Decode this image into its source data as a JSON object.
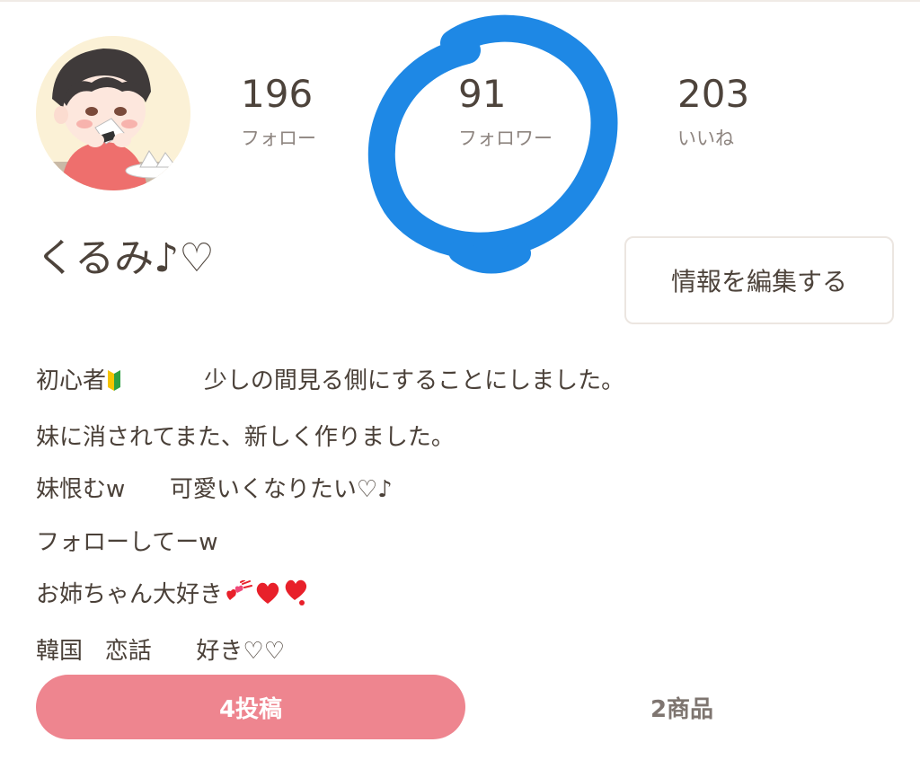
{
  "profile": {
    "username": "くるみ♪♡",
    "avatar_icon": "avatar-illustration"
  },
  "stats": {
    "following": {
      "count": "196",
      "label": "フォロー"
    },
    "followers": {
      "count": "91",
      "label": "フォロワー"
    },
    "likes": {
      "count": "203",
      "label": "いいね"
    }
  },
  "actions": {
    "edit_label": "情報を編集する"
  },
  "bio": {
    "line1_prefix": "初心者",
    "line1_suffix": "           少しの間見る側にすることにしました。",
    "line2": "妹に消されてまた、新しく作りました。",
    "line3": "妹恨むw      可愛いくなりたい♡♪",
    "line4": "フォローしてーw",
    "line5": "お姉ちゃん大好き",
    "line6": "韓国   恋話      好き♡♡"
  },
  "tabs": {
    "posts_label": "4投稿",
    "products_label": "2商品"
  },
  "colors": {
    "accent_pink": "#ee858f",
    "annotation_blue": "#1e88e5",
    "heart_red": "#e8202a",
    "text_main": "#4d433b",
    "text_muted": "#8e8580"
  }
}
